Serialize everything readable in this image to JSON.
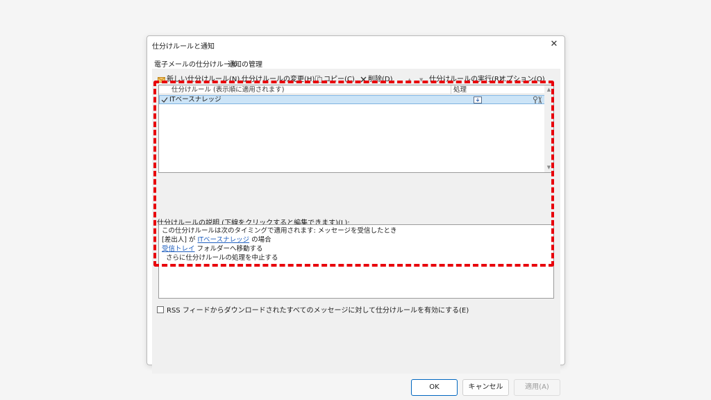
{
  "dialog": {
    "title": "仕分けルールと通知",
    "close_glyph": "✕",
    "tabs": [
      "電子メールの仕分けルール",
      "通知の管理"
    ]
  },
  "toolbar": {
    "new_rule": "新しい仕分けルール(N)...",
    "change_rule": "仕分けルールの変更(H)",
    "copy": "コピー(C)...",
    "delete": "削除(D)",
    "move_up": "▲",
    "move_down": "▼",
    "run_rules": "仕分けルールの実行(R)...",
    "options": "オプション(O)"
  },
  "rules_list": {
    "col_rule": "仕分けルール (表示順に適用されます)",
    "col_action": "処理",
    "rows": [
      {
        "name": "ITベースナレッジ",
        "checked": true
      }
    ]
  },
  "description": {
    "label": "仕分けルールの説明 (下線をクリックすると編集できます)(L):",
    "line1": "この仕分けルールは次のタイミングで適用されます: メッセージを受信したとき",
    "line2_pre": "[差出人] が ",
    "line2_link": "ITベースナレッジ",
    "line2_post": " の場合",
    "line3_link": "受信トレイ",
    "line3_post": " フォルダーへ移動する",
    "line4": "さらに仕分けルールの処理を中止する"
  },
  "rss_option": {
    "label": "RSS フィードからダウンロードされたすべてのメッセージに対して仕分けルールを有効にする(E)",
    "checked": false
  },
  "buttons": {
    "ok": "OK",
    "cancel": "キャンセル",
    "apply": "適用(A)"
  },
  "colors": {
    "highlight": "#e8000b",
    "selection": "#cce4f7",
    "link": "#1f5fbf",
    "accent": "#0067c0"
  }
}
